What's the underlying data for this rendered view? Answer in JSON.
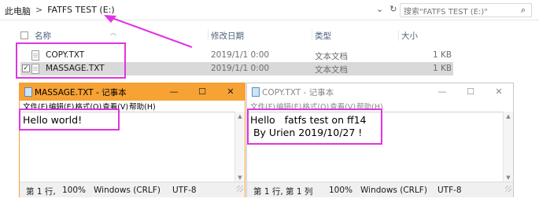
{
  "explorer": {
    "breadcrumb": [
      "此电脑",
      "FATFS TEST (E:)"
    ],
    "breadcrumb_sep": ">",
    "search_placeholder": "搜索\"FATFS TEST (E:)\"",
    "columns": {
      "name": "名称",
      "date": "修改日期",
      "type": "类型",
      "size": "大小"
    },
    "files": [
      {
        "name": "COPY.TXT",
        "date": "2019/1/1 0:00",
        "type": "文本文档",
        "size": "1 KB",
        "selected": false
      },
      {
        "name": "MASSAGE.TXT",
        "date": "2019/1/1 0:00",
        "type": "文本文档",
        "size": "1 KB",
        "selected": true
      }
    ]
  },
  "notepad_massage": {
    "title": "MASSAGE.TXT - 记事本",
    "menu": [
      "文件(F)",
      "编辑(E)",
      "格式(O)",
      "查看(V)",
      "帮助(H)"
    ],
    "content": "Hello world!",
    "status": {
      "position": "第 1 行,",
      "zoom": "100%",
      "eol": "Windows (CRLF)",
      "encoding": "UTF-8"
    },
    "buttons": {
      "minimize": "—",
      "maximize": "☐",
      "close": "✕"
    }
  },
  "notepad_copy": {
    "title": "COPY.TXT - 记事本",
    "menu": [
      "文件(F)",
      "编辑(E)",
      "格式(O)",
      "查看(V)",
      "帮助(H)"
    ],
    "content": "Hello   fatfs test on ff14\n By Urien 2019/10/27 !",
    "status": {
      "position": "第 1 行, 第 1 列",
      "zoom": "100%",
      "eol": "Windows (CRLF)",
      "encoding": "UTF-8"
    },
    "buttons": {
      "minimize": "—",
      "maximize": "☐",
      "close": "✕"
    }
  },
  "colors": {
    "annotation": "#e234e2",
    "active_title": "#f7a234"
  }
}
